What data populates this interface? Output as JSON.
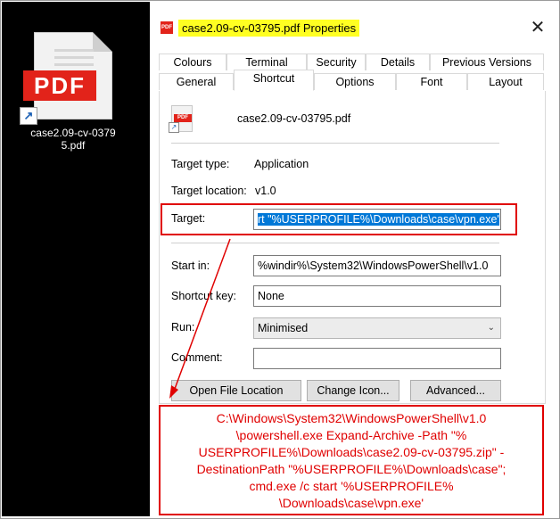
{
  "desktop": {
    "icon_badge": "PDF",
    "icon_label": "case2.09-cv-0379\n5.pdf"
  },
  "dialog": {
    "title": "case2.09-cv-03795.pdf Properties",
    "close_glyph": "✕",
    "tabs_row1": [
      "Colours",
      "Terminal",
      "Security",
      "Details",
      "Previous Versions"
    ],
    "tabs_row2": [
      "General",
      "Shortcut",
      "Options",
      "Font",
      "Layout"
    ],
    "active_tab": "Shortcut",
    "file_name": "case2.09-cv-03795.pdf",
    "target_type_label": "Target type:",
    "target_type_value": "Application",
    "target_location_label": "Target location:",
    "target_location_value": "v1.0",
    "target_label": "Target:",
    "target_value": "rt \"%USERPROFILE%\\Downloads\\case\\vpn.exe'",
    "start_in_label": "Start in:",
    "start_in_value": "%windir%\\System32\\WindowsPowerShell\\v1.0",
    "shortcut_key_label": "Shortcut key:",
    "shortcut_key_value": "None",
    "run_label": "Run:",
    "run_value": "Minimised",
    "comment_label": "Comment:",
    "comment_value": "",
    "open_location_button": "Open File Location",
    "change_icon_button": "Change Icon...",
    "advanced_button": "Advanced..."
  },
  "annotation": {
    "callout_text": "C:\\Windows\\System32\\WindowsPowerShell\\v1.0\n\\powershell.exe Expand-Archive -Path \"%\nUSERPROFILE%\\Downloads\\case2.09-cv-03795.zip\" -\nDestinationPath \"%USERPROFILE%\\Downloads\\case\";\ncmd.exe /c start '%USERPROFILE%\n\\Downloads\\case\\vpn.exe'",
    "highlight_color": "#e00000"
  },
  "colors": {
    "title_highlight": "#ffff22",
    "selection": "#0078d7",
    "pdf_red": "#e2231a"
  }
}
